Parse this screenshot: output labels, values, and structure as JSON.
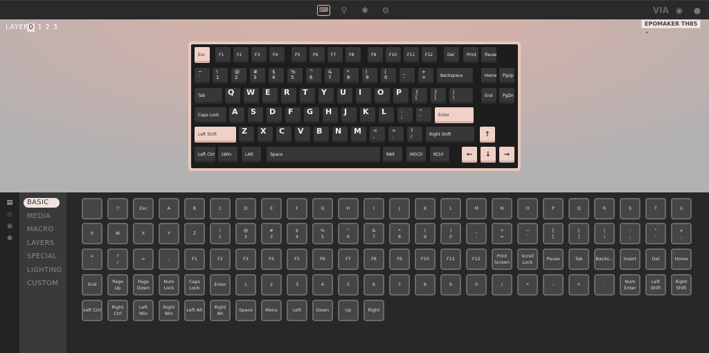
{
  "topbar": {
    "nav": [
      {
        "name": "keyboard-icon",
        "glyph": "⌨",
        "active": true
      },
      {
        "name": "remap-icon",
        "glyph": "⚲",
        "active": false
      },
      {
        "name": "bug-icon",
        "glyph": "✱",
        "active": false
      },
      {
        "name": "gear-icon",
        "glyph": "⚙",
        "active": false
      }
    ],
    "brand": "VIA",
    "discord_glyph": "◉",
    "github_glyph": "●"
  },
  "layers": {
    "label": "LAYER",
    "items": [
      "0",
      "1",
      "2",
      "3"
    ],
    "active": 0
  },
  "device_selector": {
    "value": "EPOMAKER TH85 ⌄"
  },
  "keyboard": {
    "keys": [
      {
        "l": [
          "Esc"
        ],
        "a": 1
      },
      {
        "l": [
          "F1"
        ]
      },
      {
        "l": [
          "F2"
        ]
      },
      {
        "l": [
          "F3"
        ]
      },
      {
        "l": [
          "F4"
        ]
      },
      {
        "l": [
          "F5"
        ]
      },
      {
        "l": [
          "F6"
        ]
      },
      {
        "l": [
          "F7"
        ]
      },
      {
        "l": [
          "F8"
        ]
      },
      {
        "l": [
          "F9"
        ]
      },
      {
        "l": [
          "F10"
        ]
      },
      {
        "l": [
          "F11"
        ]
      },
      {
        "l": [
          "F12"
        ]
      },
      {
        "l": [
          "Del"
        ]
      },
      {
        "l": [
          "Print"
        ]
      },
      {
        "l": [
          "Pause"
        ]
      },
      {
        "l": [
          "~",
          "`"
        ]
      },
      {
        "l": [
          "!",
          "1"
        ]
      },
      {
        "l": [
          "@",
          "2"
        ]
      },
      {
        "l": [
          "#",
          "3"
        ]
      },
      {
        "l": [
          "$",
          "4"
        ]
      },
      {
        "l": [
          "%",
          "5"
        ]
      },
      {
        "l": [
          "^",
          "6"
        ]
      },
      {
        "l": [
          "&",
          "7"
        ]
      },
      {
        "l": [
          "*",
          "8"
        ]
      },
      {
        "l": [
          "(",
          "9"
        ]
      },
      {
        "l": [
          ")",
          "0"
        ]
      },
      {
        "l": [
          "_",
          "-"
        ]
      },
      {
        "l": [
          "+",
          "="
        ]
      },
      {
        "l": [
          "Backspace"
        ]
      },
      {
        "l": [
          "Home"
        ]
      },
      {
        "l": [
          "PgUp"
        ]
      },
      {
        "l": [
          "Tab"
        ]
      },
      {
        "l": [
          "Q"
        ],
        "b": 1
      },
      {
        "l": [
          "W"
        ],
        "b": 1
      },
      {
        "l": [
          "E"
        ],
        "b": 1
      },
      {
        "l": [
          "R"
        ],
        "b": 1
      },
      {
        "l": [
          "T"
        ],
        "b": 1
      },
      {
        "l": [
          "Y"
        ],
        "b": 1
      },
      {
        "l": [
          "U"
        ],
        "b": 1
      },
      {
        "l": [
          "I"
        ],
        "b": 1
      },
      {
        "l": [
          "O"
        ],
        "b": 1
      },
      {
        "l": [
          "P"
        ],
        "b": 1
      },
      {
        "l": [
          "{",
          "["
        ]
      },
      {
        "l": [
          "}",
          "]"
        ]
      },
      {
        "l": [
          "|",
          "\\"
        ]
      },
      {
        "l": [
          "End"
        ]
      },
      {
        "l": [
          "PgDn"
        ]
      },
      {
        "l": [
          "Caps Lock"
        ]
      },
      {
        "l": [
          "A"
        ],
        "b": 1
      },
      {
        "l": [
          "S"
        ],
        "b": 1
      },
      {
        "l": [
          "D"
        ],
        "b": 1
      },
      {
        "l": [
          "F"
        ],
        "b": 1
      },
      {
        "l": [
          "G"
        ],
        "b": 1
      },
      {
        "l": [
          "H"
        ],
        "b": 1
      },
      {
        "l": [
          "J"
        ],
        "b": 1
      },
      {
        "l": [
          "K"
        ],
        "b": 1
      },
      {
        "l": [
          "L"
        ],
        "b": 1
      },
      {
        "l": [
          ":",
          ";"
        ]
      },
      {
        "l": [
          "\"",
          "'"
        ]
      },
      {
        "l": [
          "Enter"
        ],
        "a": 1
      },
      {
        "l": [
          "Left Shift"
        ],
        "a": 1
      },
      {
        "l": [
          "Z"
        ],
        "b": 1
      },
      {
        "l": [
          "X"
        ],
        "b": 1
      },
      {
        "l": [
          "C"
        ],
        "b": 1
      },
      {
        "l": [
          "V"
        ],
        "b": 1
      },
      {
        "l": [
          "B"
        ],
        "b": 1
      },
      {
        "l": [
          "N"
        ],
        "b": 1
      },
      {
        "l": [
          "M"
        ],
        "b": 1
      },
      {
        "l": [
          "<",
          ","
        ]
      },
      {
        "l": [
          ">",
          "."
        ]
      },
      {
        "l": [
          "?",
          "/"
        ]
      },
      {
        "l": [
          "Right Shift"
        ]
      },
      {
        "l": [
          "↑"
        ],
        "a": 1,
        "c": 1
      },
      {
        "l": [
          "Left Ctrl"
        ]
      },
      {
        "l": [
          "LWin"
        ]
      },
      {
        "l": [
          "LAlt"
        ]
      },
      {
        "l": [
          "Space"
        ]
      },
      {
        "l": [
          "RAlt"
        ]
      },
      {
        "l": [
          "MO(2)"
        ]
      },
      {
        "l": [
          "RCtrl"
        ]
      },
      {
        "l": [
          "←"
        ],
        "a": 1,
        "c": 1
      },
      {
        "l": [
          "↓"
        ],
        "a": 1,
        "c": 1
      },
      {
        "l": [
          "→"
        ],
        "a": 1,
        "c": 1
      }
    ]
  },
  "sidebar": {
    "icons": [
      {
        "name": "keyboard-config-icon",
        "glyph": "▤",
        "active": true
      },
      {
        "name": "macro-icon",
        "glyph": "◎",
        "active": false
      },
      {
        "name": "save-icon",
        "glyph": "▣",
        "active": false
      },
      {
        "name": "lighting-icon",
        "glyph": "●",
        "active": false
      }
    ],
    "categories": [
      "BASIC",
      "MEDIA",
      "MACRO",
      "LAYERS",
      "SPECIAL",
      "LIGHTING",
      "CUSTOM"
    ],
    "active": 0
  },
  "keycodes": [
    [
      "",
      "▽",
      "Esc",
      "A",
      "B",
      "C",
      "D",
      "E",
      "F",
      "G",
      "H",
      "I",
      "J",
      "K",
      "L",
      "M",
      "N",
      "O",
      "P",
      "Q",
      "R",
      "S",
      "T",
      "U"
    ],
    [
      "V",
      "W",
      "X",
      "Y",
      "Z",
      "!\n1",
      "@\n2",
      "#\n3",
      "$\n4",
      "%\n5",
      "^\n6",
      "&\n7",
      "*\n8",
      "(\n9",
      ")\n0",
      "_\n-",
      "+\n=",
      "~\n`",
      "{\n[",
      "}\n]",
      "|\n\\",
      ":\n;",
      "\"\n'",
      "<\n,"
    ],
    [
      ">\n.",
      "?\n/",
      "=",
      ",",
      "F1",
      "F2",
      "F3",
      "F4",
      "F5",
      "F6",
      "F7",
      "F8",
      "F9",
      "F10",
      "F11",
      "F12",
      "Print\nScreen",
      "Scroll\nLock",
      "Pause",
      "Tab",
      "Backs...",
      "Insert",
      "Del",
      "Home"
    ],
    [
      "End",
      "Page\nUp",
      "Page\nDown",
      "Num\nLock",
      "Caps\nLock",
      "Enter",
      "1",
      "2",
      "3",
      "4",
      "5",
      "6",
      "7",
      "8",
      "9",
      "0",
      "/",
      "*",
      "-",
      "+",
      ".",
      "Num\nEnter",
      "Left\nShift",
      "Right\nShift"
    ],
    [
      "Left Ctrl",
      "Right\nCtrl",
      "Left\nWin",
      "Right\nWin",
      "Left Alt",
      "Right\nAlt",
      "Space",
      "Menu",
      "Left",
      "Down",
      "Up",
      "Right"
    ]
  ]
}
